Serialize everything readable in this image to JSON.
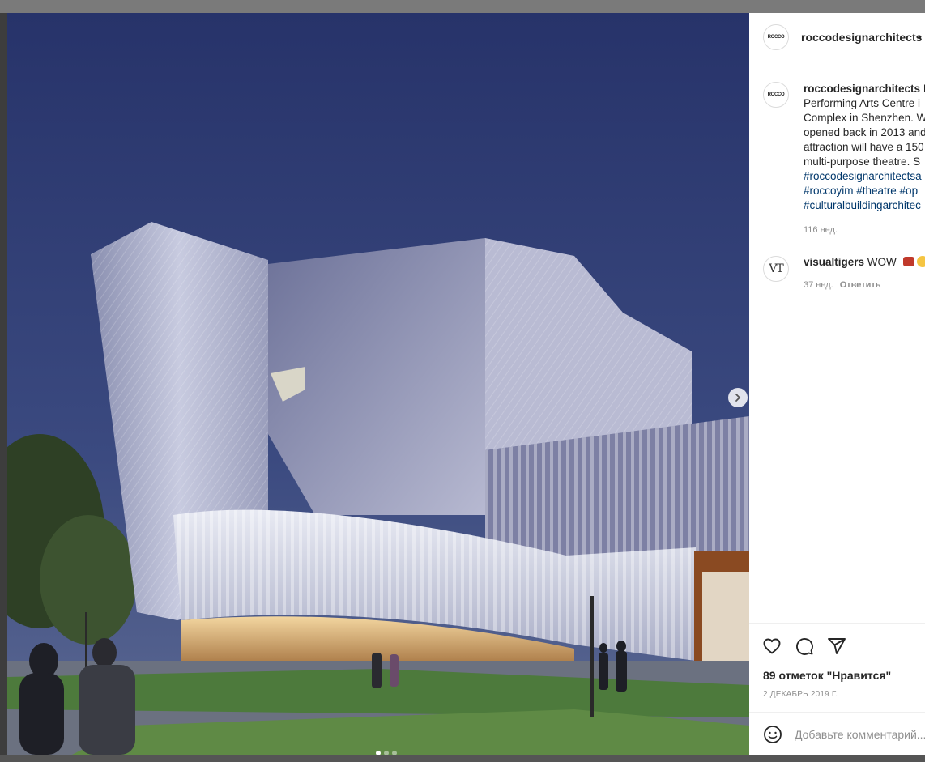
{
  "post": {
    "username": "roccodesignarchitects",
    "header_bullet": "•",
    "avatar_logo": "ROCCO",
    "caption": {
      "username": "roccodesignarchitects",
      "lines": [
        " D",
        "Performing Arts Centre i",
        "Complex in Shenzhen. W",
        "opened back in 2013 and",
        "attraction will have a 150",
        "multi-purpose theatre. S"
      ],
      "tag_lines": [
        "#roccodesignarchitectsa",
        "#roccoyim #theatre #op",
        "#culturalbuildingarchitec"
      ],
      "time": "116 нед."
    },
    "comments": [
      {
        "avatar_logo": "VT",
        "username": "visualtigers",
        "text": " WOW",
        "time": "37 нед.",
        "reply_label": "Ответить"
      }
    ],
    "likes": "89 отметок \"Нравится\"",
    "date": "2 ДЕКАБРЬ 2019 Г.",
    "add_comment_placeholder": "Добавьте комментарий..."
  },
  "media": {
    "carousel_count": 3,
    "active_index": 0
  },
  "icons": {
    "like": "heart-icon",
    "comment": "comment-icon",
    "share": "paper-plane-icon",
    "emoji": "smile-icon",
    "next": "chevron-right-icon"
  },
  "colors": {
    "sky": "#2b3866",
    "text": "#262626",
    "muted": "#8e8e8e",
    "hashtag": "#00376b"
  }
}
